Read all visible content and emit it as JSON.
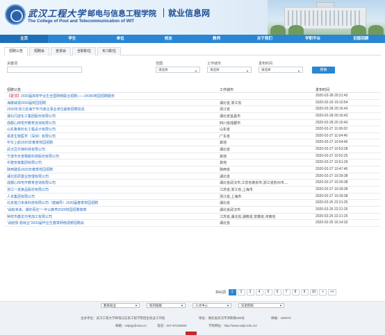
{
  "header": {
    "university_name": "武汉工程大学",
    "college_name": "邮电与信息工程学院",
    "site_name": "就业信息网",
    "college_en": "The College of Post and Telecommunication of WIT"
  },
  "nav": {
    "items": [
      "主页",
      "学生",
      "单位",
      "校友",
      "教师",
      "关于我们",
      "学职平台",
      "旧版回顾"
    ]
  },
  "tabs": [
    "招聘公告",
    "招聘会",
    "宣讲会",
    "全职职位",
    "实习职位"
  ],
  "filters": {
    "keyword_label": "关键词",
    "range_label": "范围",
    "range_value": "请选择",
    "city_label": "工作城市",
    "city_value": "请选择",
    "date_label": "发布时间",
    "date_value": "请选择",
    "search_label": "搜索"
  },
  "table": {
    "headers": [
      "招聘公告",
      "工作城市",
      "发布时间"
    ],
    "rows": [
      {
        "badge": "【置顶】",
        "title": "2020届高校毕业生全国网络联合招聘——24365校园招聘服务",
        "city": "",
        "date": "2020-02-28 20:21:43"
      },
      {
        "badge": "",
        "title": "海康威视2020届校园招聘",
        "city": "湖北省,浙江省",
        "date": "2020-02-29 19:10:54"
      },
      {
        "badge": "",
        "title": "2020年浙江省海宁市75家企事业单位最新招聘信息",
        "city": "浙江省",
        "date": "2020-02-28 20:16:43"
      },
      {
        "badge": "",
        "title": "湖北闪送化工集团股份有限公司",
        "city": "湖北省宜昌市",
        "date": "2020-02-28 20:16:43"
      },
      {
        "badge": "",
        "title": "成都心田宅开教育咨询有限公司",
        "city": "四川省成都市",
        "date": "2020-02-28 20:16:43"
      },
      {
        "badge": "",
        "title": "山东鲁泰石化工程设计有限公司",
        "city": "山东省",
        "date": "2020-02-27 11:06:02"
      },
      {
        "badge": "",
        "title": "易发生物医学（深圳）有限公司",
        "city": "广东省",
        "date": "2020-02-27 11:04:49"
      },
      {
        "badge": "",
        "title": "中交上航2020年春季校园招聘",
        "city": "其他",
        "date": "2020-02-27 10:54:45"
      },
      {
        "badge": "",
        "title": "武汉豆乐锦科技有限公司",
        "city": "湖北省",
        "date": "2020-02-27 10:53:28"
      },
      {
        "badge": "",
        "title": "宁波市天普橡胶科技股份有限公司",
        "city": "其他",
        "date": "2020-02-27 10:52:25"
      },
      {
        "badge": "",
        "title": "中建安装集团有限公司",
        "city": "其他",
        "date": "2020-02-27 10:51:29"
      },
      {
        "badge": "",
        "title": "陕西建投2020年春季校园招聘",
        "city": "陕西省",
        "date": "2020-02-27 10:47:40"
      },
      {
        "badge": "",
        "title": "湖北凯辰置业管理有限公司",
        "city": "湖北省",
        "date": "2020-02-27 10:39:38"
      },
      {
        "badge": "",
        "title": "成都心田宅开教育咨询有限公司",
        "city": "湖北省武汉市,江苏省南京市,浙江省杭州市,...",
        "date": "2020-02-27 10:39:38"
      },
      {
        "badge": "",
        "title": "浙江一诺食品股份有限公司",
        "city": "江苏省,浙江省,上海市",
        "date": "2020-02-27 10:39:38"
      },
      {
        "badge": "",
        "title": "人本集团有限公司",
        "city": "浙江省,上海市",
        "date": "2020-02-27 10:39:38"
      },
      {
        "badge": "",
        "title": "北京猎力未来科技有限公司（猿辅导）2020届春季校园招聘",
        "city": "湖北省",
        "date": "2020-02-25 22:21:25"
      },
      {
        "badge": "",
        "title": "“战疫未来，爆你而在”一中公教育2020校园招聘简章",
        "city": "湖北省武汉市",
        "date": "2020-02-25 22:21:25"
      },
      {
        "badge": "",
        "title": "钟祥市鑫龙光电加工有限公司",
        "city": "江苏省,湖北省,湖南省,安徽省,河南省",
        "date": "2020-02-25 22:21:25"
      },
      {
        "badge": "",
        "title": "“战疫情 稳就业”2020届毕业生春季网络视频招聘会",
        "city": "湖北省",
        "date": "2020-02-25 16:14:33"
      }
    ]
  },
  "pagination": {
    "total": "共41页",
    "pages": [
      "1",
      "2",
      "3",
      "4",
      "5",
      "6",
      "7",
      "8",
      "9",
      "10",
      ">",
      ">>"
    ],
    "current": "1"
  },
  "footer_links": [
    "教育就业",
    "校内链接",
    "人才中心",
    "兄弟院校"
  ],
  "footer": {
    "sponsor": "主办单位：武汉工程大学邮电与信息工程学院招生就业工作处",
    "address": "地址：湖北省武汉市洪斯路368号",
    "postcode": "邮编：430073",
    "email": "邮箱：witptjy@sina.cn",
    "phone": "电话：027-87195083",
    "website": "学校网址：http://www.witpt.edu.cn/"
  }
}
